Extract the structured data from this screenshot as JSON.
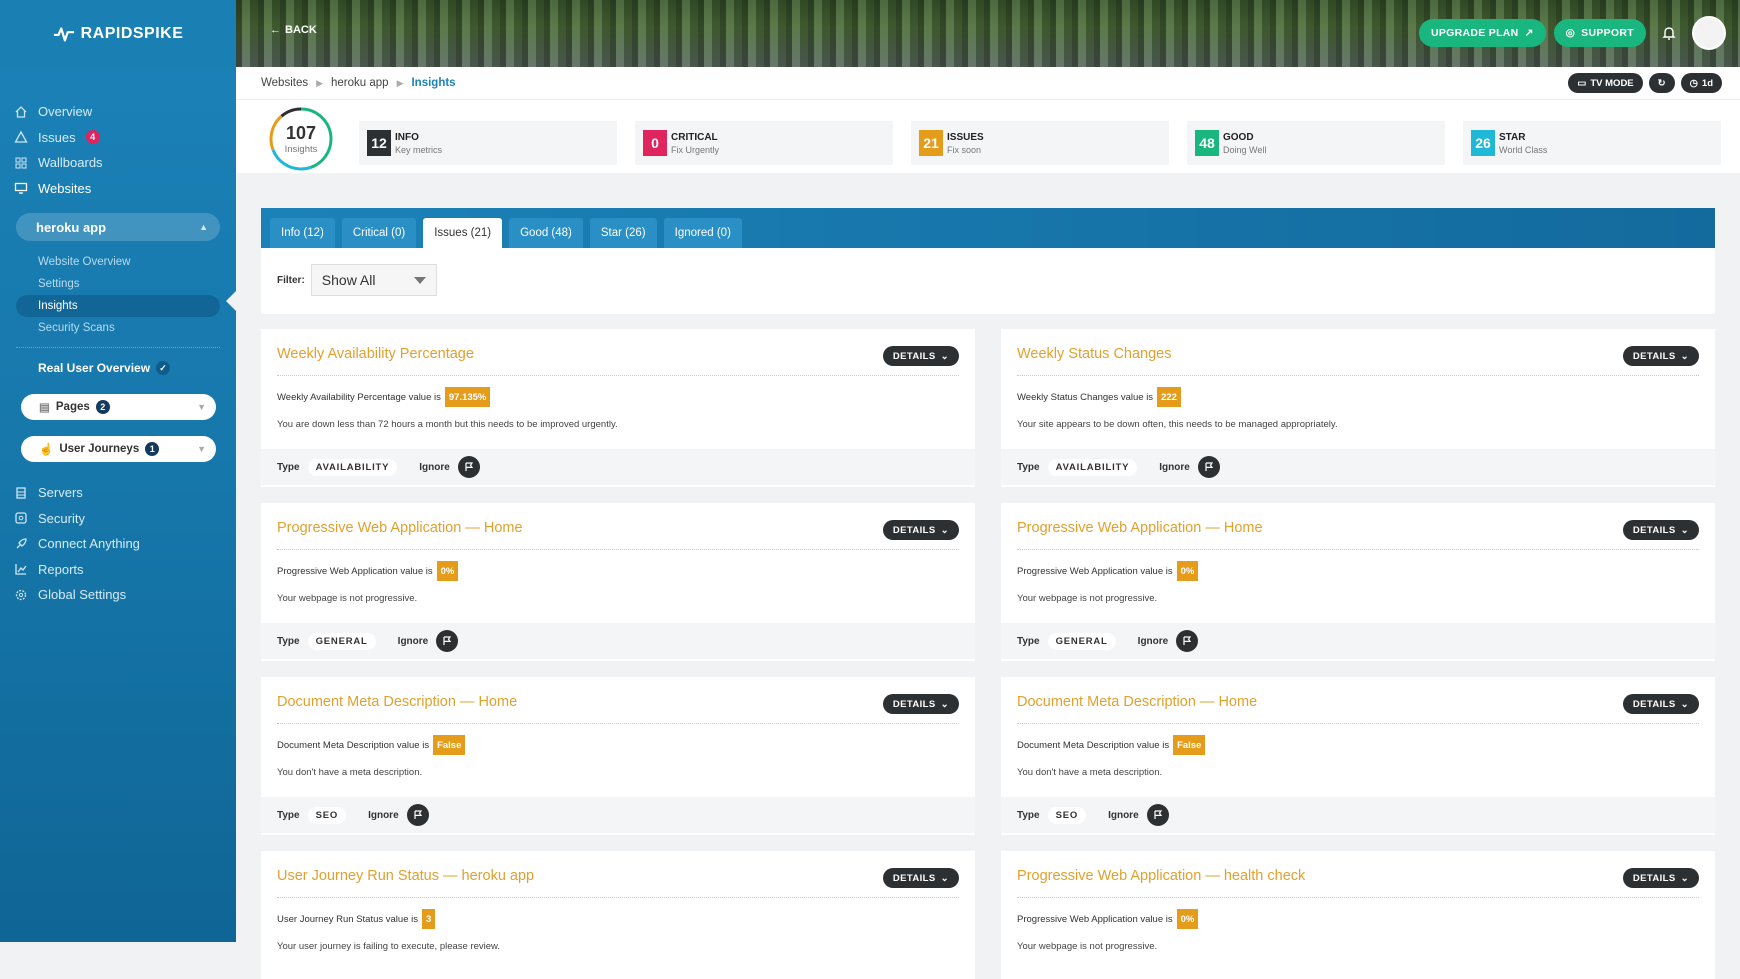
{
  "brand": {
    "name": "RAPIDSPIKE"
  },
  "sidebar": {
    "nav_top": [
      {
        "label": "Overview",
        "icon": "home-icon"
      },
      {
        "label": "Issues",
        "icon": "warning-icon",
        "badge": "4"
      },
      {
        "label": "Wallboards",
        "icon": "grid-icon"
      },
      {
        "label": "Websites",
        "icon": "monitor-icon"
      }
    ],
    "site_select": "heroku app",
    "sub_items": [
      "Website Overview",
      "Settings",
      "Insights",
      "Security Scans"
    ],
    "real_user_overview": "Real User Overview",
    "pages": {
      "label": "Pages",
      "badge": "2"
    },
    "user_journeys": {
      "label": "User Journeys",
      "badge": "1"
    },
    "nav_bottom": [
      {
        "label": "Servers",
        "icon": "server-icon"
      },
      {
        "label": "Security",
        "icon": "shield-icon"
      },
      {
        "label": "Connect Anything",
        "icon": "rocket-icon"
      },
      {
        "label": "Reports",
        "icon": "chart-icon"
      },
      {
        "label": "Global Settings",
        "icon": "gear-icon"
      }
    ]
  },
  "header": {
    "back": "BACK",
    "upgrade": "UPGRADE PLAN",
    "support": "SUPPORT"
  },
  "breadcrumb": [
    "Websites",
    "heroku app",
    "Insights"
  ],
  "tools": {
    "tv_mode": "TV MODE",
    "range": "1d"
  },
  "summary": {
    "total": "107",
    "total_label": "Insights",
    "stats": [
      {
        "num": "12",
        "title": "INFO",
        "sub": "Key metrics",
        "color": "#2d3033"
      },
      {
        "num": "0",
        "title": "CRITICAL",
        "sub": "Fix Urgently",
        "color": "#e0245e"
      },
      {
        "num": "21",
        "title": "ISSUES",
        "sub": "Fix soon",
        "color": "#e59c1a"
      },
      {
        "num": "48",
        "title": "GOOD",
        "sub": "Doing Well",
        "color": "#19b67f"
      },
      {
        "num": "26",
        "title": "STAR",
        "sub": "World Class",
        "color": "#1fb8d6"
      }
    ]
  },
  "tabs": [
    "Info (12)",
    "Critical (0)",
    "Issues (21)",
    "Good (48)",
    "Star (26)",
    "Ignored (0)"
  ],
  "filter": {
    "label": "Filter:",
    "value": "Show All"
  },
  "cards": [
    {
      "title": "Weekly Availability Percentage",
      "value_prefix": "Weekly Availability Percentage value is",
      "value": "97.135%",
      "desc": "You are down less than 72 hours a month but this needs to be improved urgently.",
      "type": "AVAILABILITY"
    },
    {
      "title": "Weekly Status Changes",
      "value_prefix": "Weekly Status Changes value is",
      "value": "222",
      "desc": "Your site appears to be down often, this needs to be managed appropriately.",
      "type": "AVAILABILITY"
    },
    {
      "title": "Progressive Web Application — Home",
      "value_prefix": "Progressive Web Application value is",
      "value": "0%",
      "desc": "Your webpage is not progressive.",
      "type": "GENERAL"
    },
    {
      "title": "Progressive Web Application — Home",
      "value_prefix": "Progressive Web Application value is",
      "value": "0%",
      "desc": "Your webpage is not progressive.",
      "type": "GENERAL"
    },
    {
      "title": "Document Meta Description — Home",
      "value_prefix": "Document Meta Description value is",
      "value": "False",
      "desc": "You don't have a meta description.",
      "type": "SEO"
    },
    {
      "title": "Document Meta Description — Home",
      "value_prefix": "Document Meta Description value is",
      "value": "False",
      "desc": "You don't have a meta description.",
      "type": "SEO"
    },
    {
      "title": "User Journey Run Status — heroku app",
      "value_prefix": "User Journey Run Status value is",
      "value": "3",
      "desc": "Your user journey is failing to execute, please review.",
      "type": ""
    },
    {
      "title": "Progressive Web Application — health check",
      "value_prefix": "Progressive Web Application value is",
      "value": "0%",
      "desc": "Your webpage is not progressive.",
      "type": ""
    }
  ],
  "labels": {
    "details": "DETAILS",
    "type": "Type",
    "ignore": "Ignore"
  }
}
